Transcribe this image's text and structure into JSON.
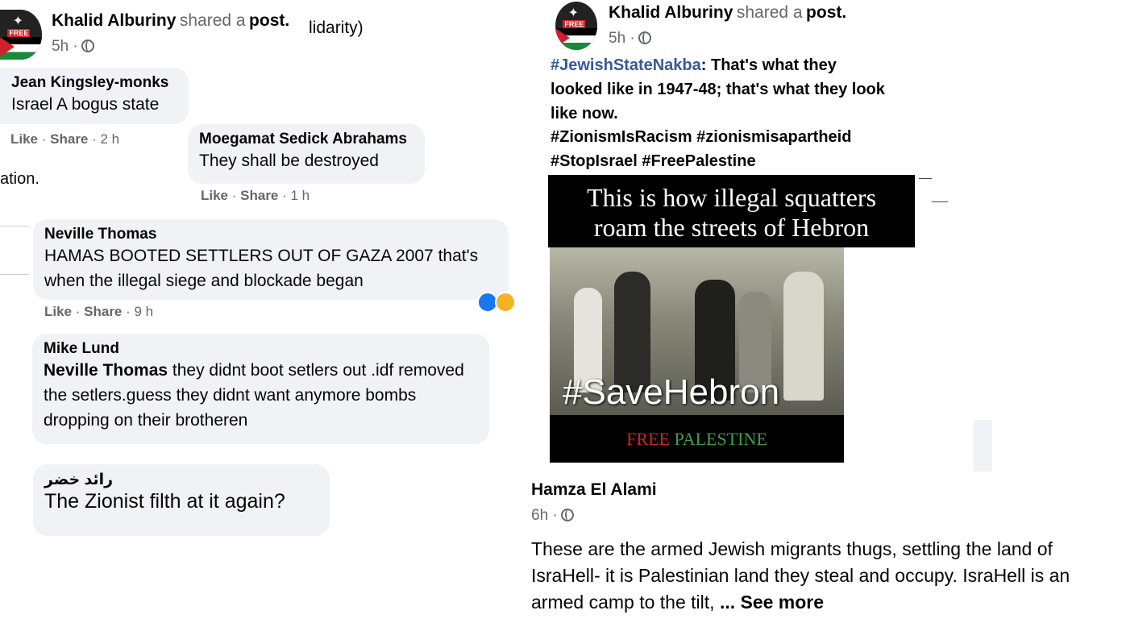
{
  "left_header": {
    "author": "Khalid Alburiny",
    "shared_text": "shared a",
    "post_word": "post.",
    "cut_text": "lidarity)",
    "time": "5h ·"
  },
  "comments": [
    {
      "name": "Jean Kingsley-monks",
      "text": "Israel A bogus state",
      "like": "Like",
      "share": "Share",
      "time": "· 2 h"
    },
    {
      "name": "Moegamat Sedick Abrahams",
      "text": "They shall be destroyed",
      "like": "Like",
      "share": "Share",
      "time": "· 1 h"
    },
    {
      "name": "Neville Thomas",
      "text": "HAMAS BOOTED SETTLERS OUT OF GAZA 2007 that's when the illegal siege and blockade began",
      "like": "Like",
      "share": "Share",
      "time": "· 9 h"
    },
    {
      "name": "Mike Lund",
      "mention": "Neville Thomas",
      "text": " they didnt boot setlers out .idf removed the setlers.guess they didnt want anymore bombs dropping on their brotheren"
    },
    {
      "name": "رائد خضر",
      "text": "The Zionist filth at it again?"
    }
  ],
  "left_fragment": "ation.",
  "right_header": {
    "author": "Khalid Alburiny",
    "shared_text": "shared a",
    "post_word": "post.",
    "time": "5h ·"
  },
  "right_post": {
    "hashtag1": "#JewishStateNakba",
    "text1": ": That's what they looked like in 1947-48; that's what they look like now.",
    "hashtags_line1": "#ZionismIsRacism #zionismisapartheid",
    "hashtags_line2": "#StopIsrael #FreePalestine"
  },
  "poster": {
    "headline_line1": "This is how illegal squatters",
    "headline_line2": "roam the streets of Hebron",
    "hashtag": "#SaveHebron",
    "free": "FREE",
    "palestine": "PALESTINE"
  },
  "bottom_post": {
    "author": "Hamza El Alami",
    "time": "6h ·",
    "text": "These are the armed Jewish migrants thugs, settling the land of IsraHell- it is Palestinian land they steal and occupy. IsraHell is an armed camp to the tilt,",
    "see_more": "... See more"
  },
  "avatar_badge": "FREE"
}
